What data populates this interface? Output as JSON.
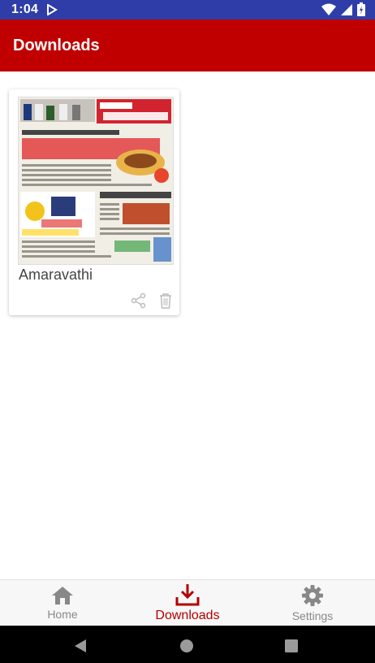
{
  "status_bar": {
    "time": "1:04"
  },
  "app_bar": {
    "title": "Downloads"
  },
  "downloads": [
    {
      "name": "Amaravathi"
    }
  ],
  "bottom_nav": {
    "items": [
      {
        "label": "Home",
        "icon": "home-icon"
      },
      {
        "label": "Downloads",
        "icon": "download-icon",
        "active": true
      },
      {
        "label": "Settings",
        "icon": "gear-icon"
      }
    ]
  },
  "colors": {
    "status_bar": "#2e3da8",
    "app_bar": "#c00000",
    "active_nav": "#b30000",
    "inactive_nav": "#888888"
  }
}
